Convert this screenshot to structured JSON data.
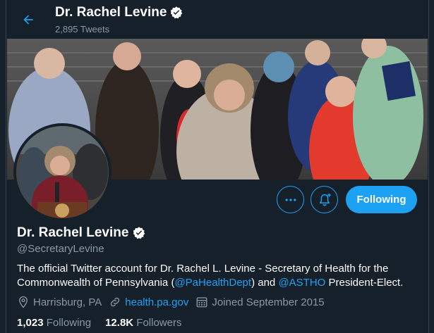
{
  "header": {
    "name": "Dr. Rachel Levine",
    "tweet_count": "2,895 Tweets"
  },
  "profile": {
    "name": "Dr. Rachel Levine",
    "handle": "@SecretaryLevine",
    "bio": {
      "part1": "The official Twitter account for Dr. Rachel L. Levine - Secretary of Health for the Commonwealth of Pennsylvania (",
      "mention1": "@PaHealthDept",
      "part2": ") and ",
      "mention2": "@ASTHO",
      "part3": " President-Elect."
    },
    "location": "Harrisburg, PA",
    "website": "health.pa.gov",
    "joined": "Joined September 2015",
    "following_count": "1,023",
    "following_label": "Following",
    "followers_count": "12.8K",
    "followers_label": "Followers"
  },
  "actions": {
    "follow_label": "Following"
  },
  "icons": {
    "back": "arrow-left-icon",
    "verified": "verified-badge-icon",
    "more": "more-dots-icon",
    "notify": "bell-plus-icon",
    "location": "map-pin-icon",
    "link": "link-icon",
    "calendar": "calendar-icon"
  },
  "colors": {
    "background": "#15202b",
    "accent": "#1da1f2",
    "secondary_text": "#8899a6"
  }
}
